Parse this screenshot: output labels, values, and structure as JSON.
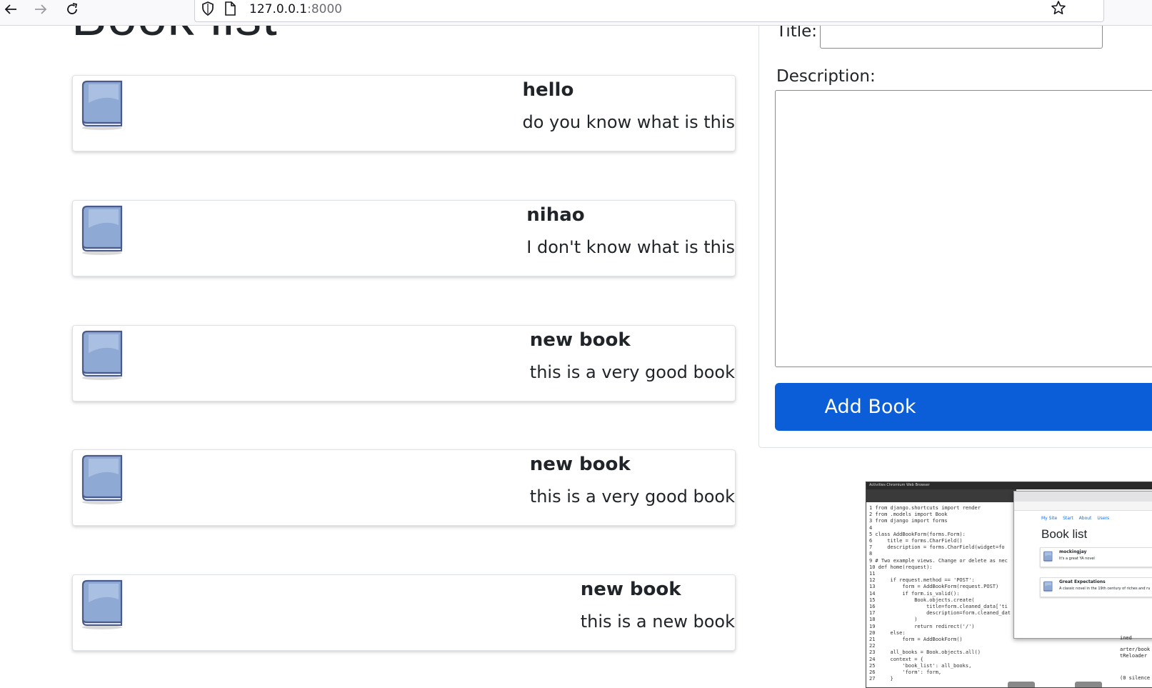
{
  "browser": {
    "url_host": "127.0.0.1",
    "url_port": ":8000"
  },
  "page": {
    "title": "Book list"
  },
  "books": [
    {
      "title": "hello",
      "description": "do you know what is this"
    },
    {
      "title": "nihao",
      "description": "I don't know what is this"
    },
    {
      "title": "new book",
      "description": "this is a very good book"
    },
    {
      "title": "new book",
      "description": "this is a very good book"
    },
    {
      "title": "new book",
      "description": "this is a new book"
    }
  ],
  "form": {
    "title_label": "Title:",
    "title_value": "",
    "description_label": "Description:",
    "description_value": "",
    "submit_label": "Add Book"
  },
  "thumbnail": {
    "topbar_text": "Activities   Chromium Web Browser",
    "code": "1 from django.shortcuts import render\n2 from .models import Book\n3 from django import forms\n4\n5 class AddBookForm(forms.Form):\n6     title = forms.CharField()\n7     description = forms.CharField(widget=fo\n8\n9 # Two example views. Change or delete as nec\n10 def home(request):\n11\n12     if request.method == 'POST':\n13         form = AddBookForm(request.POST)\n14         if form.is_valid():\n15             Book.objects.create(\n16                 title=form.cleaned_data['ti\n17                 description=form.cleaned_dat\n18             )\n19             return redirect('/')\n20     else:\n21         form = AddBookForm()\n22\n23     all_books = Book.objects.all()\n24     context = {\n25         'book_list': all_books,\n26         'form': form,\n27     }",
    "nav": [
      "My Site",
      "Start",
      "About",
      "Users"
    ],
    "title": "Book list",
    "books": [
      {
        "title": "mockingjay",
        "description": "It's a great YA novel"
      },
      {
        "title": "Great Expectations",
        "description": "A classic novel in the 19th century of riches and ru"
      }
    ],
    "side_text": [
      "ined",
      "arter/book",
      "tReloader",
      "(0 silence"
    ]
  },
  "colors": {
    "accent": "#0b5ed7",
    "border": "#dee2e6",
    "text": "#212529"
  }
}
